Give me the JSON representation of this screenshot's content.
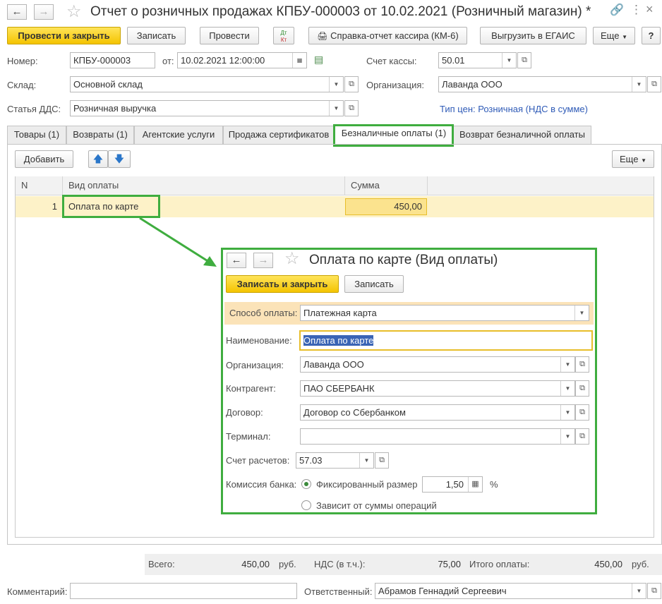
{
  "window": {
    "title": "Отчет о розничных продажах КПБУ-000003 от 10.02.2021 (Розничный магазин) *",
    "link_icon": "link-icon",
    "menu_icon": "more-vertical-icon",
    "close_icon": "close-icon"
  },
  "toolbar": {
    "post_close": "Провести и закрыть",
    "save": "Записать",
    "post": "Провести",
    "dt_kt_top": "Дт",
    "dt_kt_bottom": "Кт",
    "cashier_report": "Справка-отчет кассира (КМ-6)",
    "egais": "Выгрузить в ЕГАИС",
    "more": "Еще",
    "help": "?"
  },
  "header": {
    "number_label": "Номер:",
    "number": "КПБУ-000003",
    "date_label": "от:",
    "date": "10.02.2021 12:00:00",
    "cash_account_label": "Счет кассы:",
    "cash_account": "50.01",
    "warehouse_label": "Склад:",
    "warehouse": "Основной склад",
    "org_label": "Организация:",
    "org": "Лаванда ООО",
    "dds_label": "Статья ДДС:",
    "dds": "Розничная выручка",
    "price_type_link": "Тип цен: Розничная (НДС в сумме)"
  },
  "tabs": [
    {
      "label": "Товары (1)"
    },
    {
      "label": "Возвраты (1)"
    },
    {
      "label": "Агентские услуги"
    },
    {
      "label": "Продажа сертификатов"
    },
    {
      "label": "Безналичные оплаты (1)"
    },
    {
      "label": "Возврат безналичной оплаты"
    }
  ],
  "active_tab": "Безналичные оплаты (1)",
  "table_toolbar": {
    "add": "Добавить",
    "more": "Еще"
  },
  "table": {
    "columns": [
      "N",
      "Вид оплаты",
      "Сумма"
    ],
    "rows": [
      {
        "n": "1",
        "kind": "Оплата по карте",
        "sum": "450,00"
      }
    ]
  },
  "dialog": {
    "title": "Оплата по карте (Вид оплаты)",
    "save_close": "Записать и закрыть",
    "save": "Записать",
    "method_label": "Способ оплаты:",
    "method": "Платежная карта",
    "name_label": "Наименование:",
    "name": "Оплата по карте",
    "org_label": "Организация:",
    "org": "Лаванда ООО",
    "counterparty_label": "Контрагент:",
    "counterparty": "ПАО СБЕРБАНК",
    "contract_label": "Договор:",
    "contract": "Договор со Сбербанком",
    "terminal_label": "Терминал:",
    "terminal": "",
    "account_label": "Счет расчетов:",
    "account": "57.03",
    "commission_label": "Комиссия банка:",
    "fixed_label": "Фиксированный размер",
    "fixed_value": "1,50",
    "percent_sign": "%",
    "depends_label": "Зависит от суммы операций"
  },
  "footer": {
    "total_label": "Всего:",
    "total": "450,00",
    "total_cur": "руб.",
    "vat_label": "НДС (в т.ч.):",
    "vat": "75,00",
    "payment_label": "Итого оплаты:",
    "payment": "450,00",
    "payment_cur": "руб.",
    "comment_label": "Комментарий:",
    "comment": "",
    "responsible_label": "Ответственный:",
    "responsible": "Абрамов Геннадий Сергеевич"
  },
  "colors": {
    "accent_yellow": "#f4c400",
    "highlight_green": "#3fad3f",
    "row_selected": "#fdf2c8",
    "link": "#2f5bb7"
  }
}
